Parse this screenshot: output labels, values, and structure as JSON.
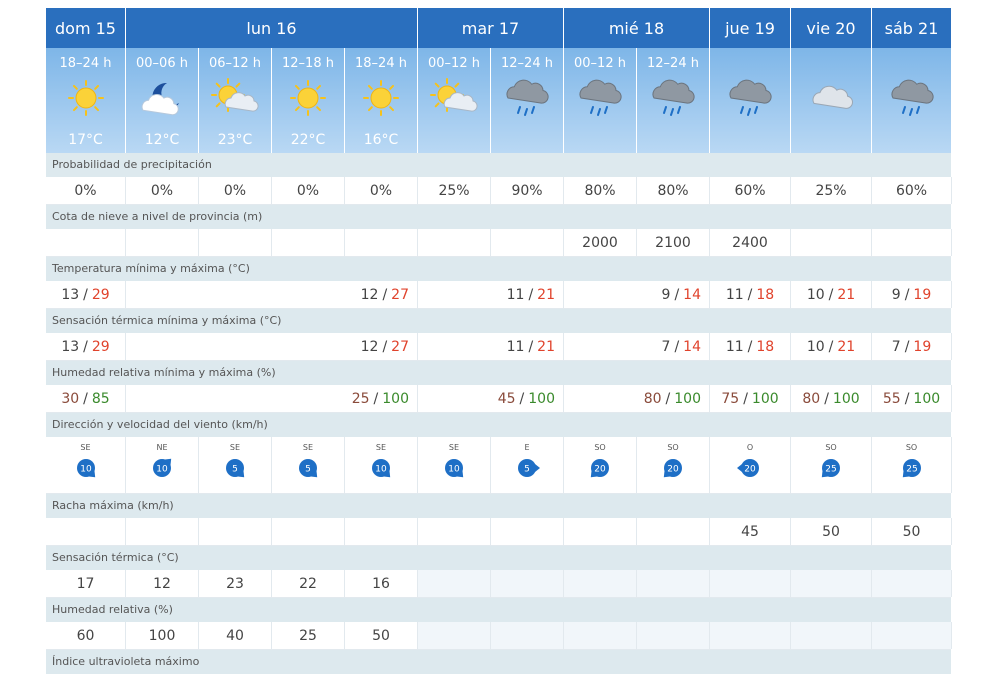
{
  "colors": {
    "header_bg": "#2a6fbe",
    "period_bg_top": "#7eb6e8",
    "period_bg_bottom": "#b9d8f4",
    "label_bg": "#dde9ee",
    "max_red": "#e0432c",
    "humidity_green": "#3a8a2c",
    "humidity_brown": "#8a4b3b",
    "wind_badge": "#1e6fc6"
  },
  "days": [
    {
      "label": "dom 15",
      "span": 1
    },
    {
      "label": "lun 16",
      "span": 4
    },
    {
      "label": "mar 17",
      "span": 2
    },
    {
      "label": "mié 18",
      "span": 2
    },
    {
      "label": "jue 19",
      "span": 1
    },
    {
      "label": "vie 20",
      "span": 1
    },
    {
      "label": "sáb 21",
      "span": 1
    }
  ],
  "periods": [
    {
      "label": "18–24 h",
      "icon": "sun-icon",
      "temp": "17°C"
    },
    {
      "label": "00–06 h",
      "icon": "moon-cloud-icon",
      "temp": "12°C"
    },
    {
      "label": "06–12 h",
      "icon": "sun-cloud-icon",
      "temp": "23°C"
    },
    {
      "label": "12–18 h",
      "icon": "sun-icon",
      "temp": "22°C"
    },
    {
      "label": "18–24 h",
      "icon": "sun-icon",
      "temp": "16°C"
    },
    {
      "label": "00–12 h",
      "icon": "sun-cloud-icon",
      "temp": ""
    },
    {
      "label": "12–24 h",
      "icon": "rain-cloud-icon",
      "temp": ""
    },
    {
      "label": "00–12 h",
      "icon": "rain-cloud-icon",
      "temp": ""
    },
    {
      "label": "12–24 h",
      "icon": "rain-cloud-icon",
      "temp": ""
    },
    {
      "label": "",
      "icon": "rain-cloud-icon",
      "temp": ""
    },
    {
      "label": "",
      "icon": "cloud-icon",
      "temp": ""
    },
    {
      "label": "",
      "icon": "rain-cloud-icon",
      "temp": ""
    }
  ],
  "rows": [
    {
      "label": "Probabilidad de precipitación",
      "kind": "single",
      "values": [
        "0%",
        "0%",
        "0%",
        "0%",
        "0%",
        "25%",
        "90%",
        "80%",
        "80%",
        "60%",
        "25%",
        "60%"
      ]
    },
    {
      "label": "Cota de nieve a nivel de provincia (m)",
      "kind": "single",
      "values": [
        "",
        "",
        "",
        "",
        "",
        "",
        "",
        "2000",
        "2100",
        "2400",
        "",
        ""
      ]
    },
    {
      "label": "Temperatura mínima y máxima (°C)",
      "kind": "minmax",
      "values": [
        {
          "min": "13",
          "max": "29"
        },
        {
          "min": "12",
          "max": "27"
        },
        {
          "min": "11",
          "max": "21"
        },
        {
          "min": "9",
          "max": "14"
        },
        {
          "min": "11",
          "max": "18"
        },
        {
          "min": "10",
          "max": "21"
        },
        {
          "min": "9",
          "max": "19"
        }
      ]
    },
    {
      "label": "Sensación térmica mínima y máxima (°C)",
      "kind": "minmax",
      "values": [
        {
          "min": "13",
          "max": "29"
        },
        {
          "min": "12",
          "max": "27"
        },
        {
          "min": "11",
          "max": "21"
        },
        {
          "min": "7",
          "max": "14"
        },
        {
          "min": "11",
          "max": "18"
        },
        {
          "min": "10",
          "max": "21"
        },
        {
          "min": "7",
          "max": "19"
        }
      ]
    },
    {
      "label": "Humedad relativa mínima y máxima (%)",
      "kind": "humidity",
      "values": [
        {
          "min": "30",
          "max": "85"
        },
        {
          "min": "25",
          "max": "100"
        },
        {
          "min": "45",
          "max": "100"
        },
        {
          "min": "80",
          "max": "100"
        },
        {
          "min": "75",
          "max": "100"
        },
        {
          "min": "80",
          "max": "100"
        },
        {
          "min": "55",
          "max": "100"
        }
      ]
    },
    {
      "label": "Dirección y velocidad del viento (km/h)",
      "kind": "wind",
      "values": [
        {
          "dir": "SE",
          "speed": "10"
        },
        {
          "dir": "NE",
          "speed": "10"
        },
        {
          "dir": "SE",
          "speed": "5"
        },
        {
          "dir": "SE",
          "speed": "5"
        },
        {
          "dir": "SE",
          "speed": "10"
        },
        {
          "dir": "SE",
          "speed": "10"
        },
        {
          "dir": "E",
          "speed": "5"
        },
        {
          "dir": "SO",
          "speed": "20"
        },
        {
          "dir": "SO",
          "speed": "20"
        },
        {
          "dir": "O",
          "speed": "20"
        },
        {
          "dir": "SO",
          "speed": "25"
        },
        {
          "dir": "SO",
          "speed": "25"
        }
      ]
    },
    {
      "label": "Racha máxima (km/h)",
      "kind": "single",
      "values": [
        "",
        "",
        "",
        "",
        "",
        "",
        "",
        "",
        "",
        "45",
        "50",
        "50"
      ]
    },
    {
      "label": "Sensación térmica (°C)",
      "kind": "single",
      "values": [
        "17",
        "12",
        "23",
        "22",
        "16",
        "",
        "",
        "",
        "",
        "",
        "",
        ""
      ]
    },
    {
      "label": "Humedad relativa (%)",
      "kind": "single",
      "values": [
        "60",
        "100",
        "40",
        "25",
        "50",
        "",
        "",
        "",
        "",
        "",
        "",
        ""
      ]
    },
    {
      "label": "Índice ultravioleta máximo",
      "kind": "labelonly"
    }
  ]
}
